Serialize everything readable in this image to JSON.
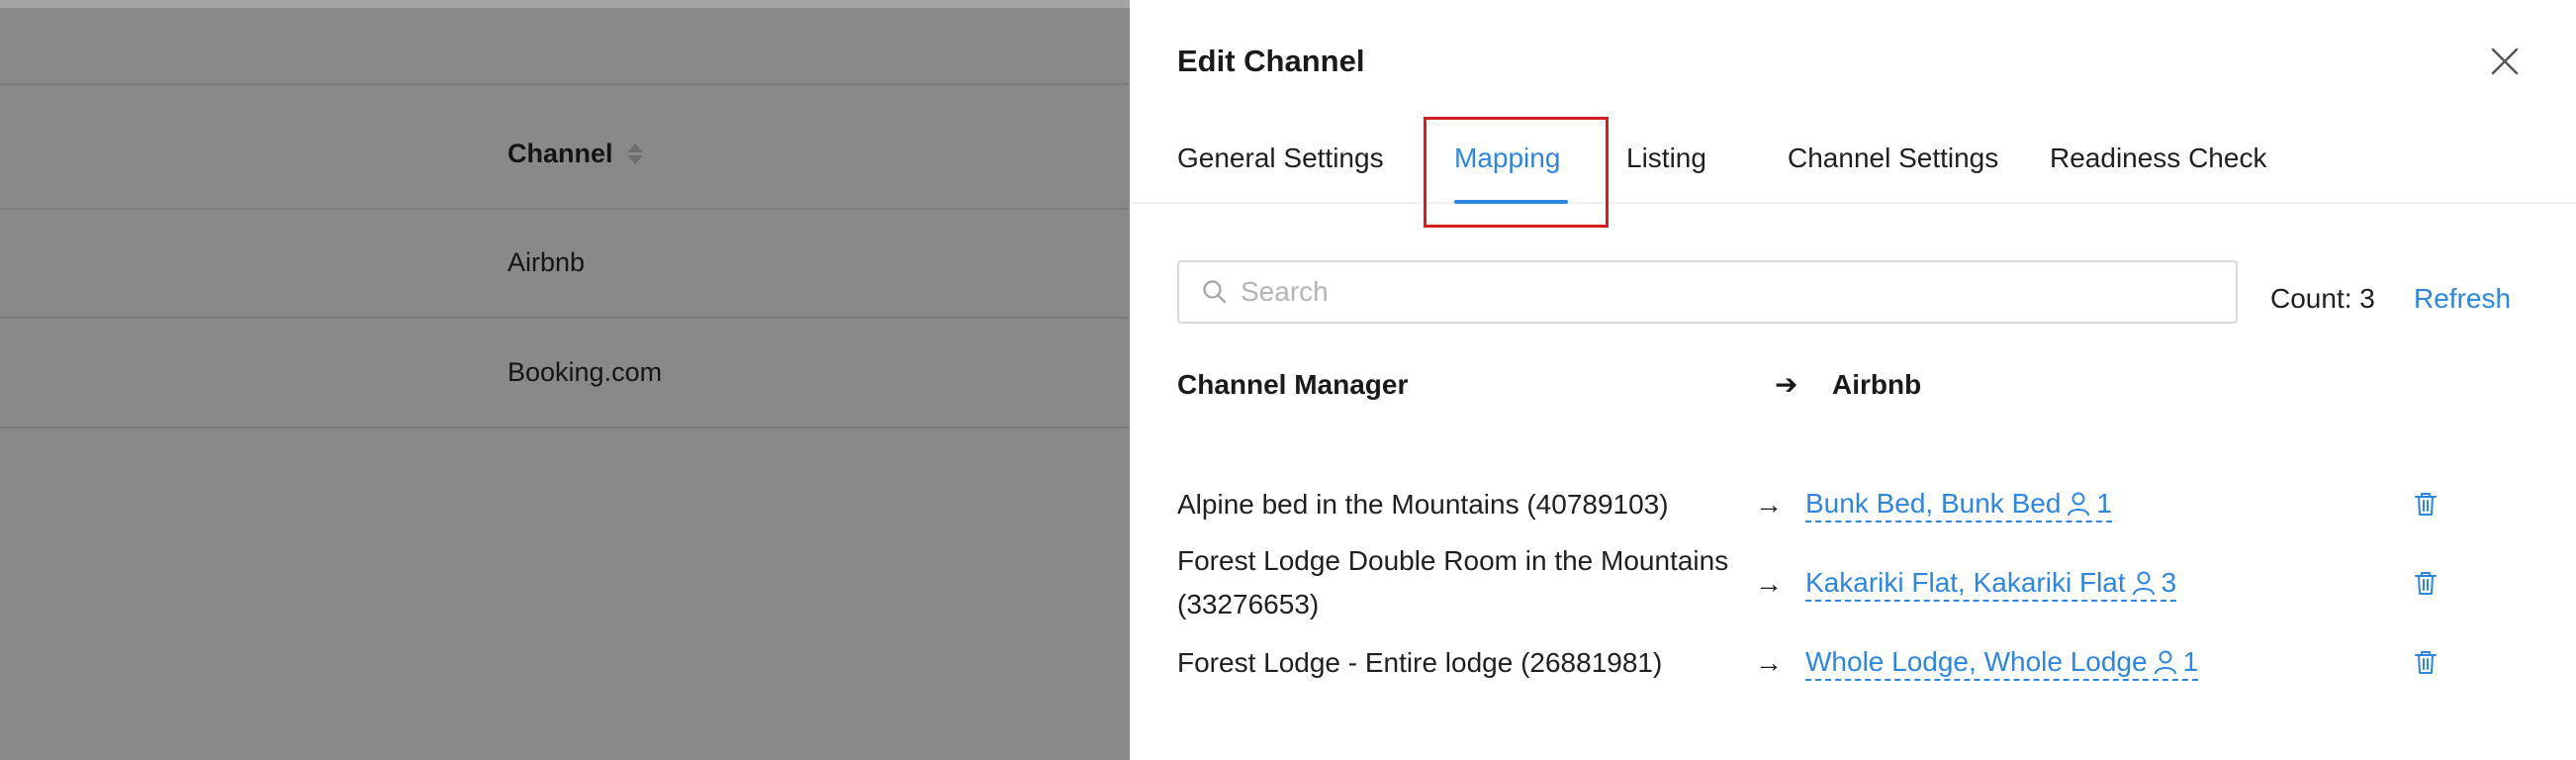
{
  "background_table": {
    "header": "Channel",
    "rows": [
      "Airbnb",
      "Booking.com"
    ]
  },
  "drawer": {
    "title": "Edit Channel",
    "tabs": [
      {
        "label": "General Settings"
      },
      {
        "label": "Mapping"
      },
      {
        "label": "Listing"
      },
      {
        "label": "Channel Settings"
      },
      {
        "label": "Readiness Check"
      }
    ],
    "active_tab": "Mapping",
    "search": {
      "placeholder": "Search",
      "value": ""
    },
    "count_label": "Count: 3",
    "refresh_label": "Refresh",
    "columns": {
      "left": "Channel Manager",
      "arrow": "➔",
      "right": "Airbnb"
    },
    "mappings": [
      {
        "source_line1": "Alpine bed in the Mountains (40789103)",
        "source_line2": "",
        "target": "Bunk Bed, Bunk Bed",
        "guests": "1"
      },
      {
        "source_line1": "Forest Lodge Double Room in the Mountains",
        "source_line2": "(33276653)",
        "target": "Kakariki Flat, Kakariki Flat",
        "guests": "3"
      },
      {
        "source_line1": "Forest Lodge - Entire lodge (26881981)",
        "source_line2": "",
        "target": "Whole Lodge, Whole Lodge",
        "guests": "1"
      }
    ],
    "row_arrow": "→"
  },
  "colors": {
    "accent": "#2f86de",
    "highlight": "#d41f1f",
    "overlay": "#898989"
  },
  "icons": {
    "close": "close-icon",
    "search": "search-icon",
    "guest": "user-icon",
    "delete": "trash-icon",
    "sort": "sort-icon"
  }
}
